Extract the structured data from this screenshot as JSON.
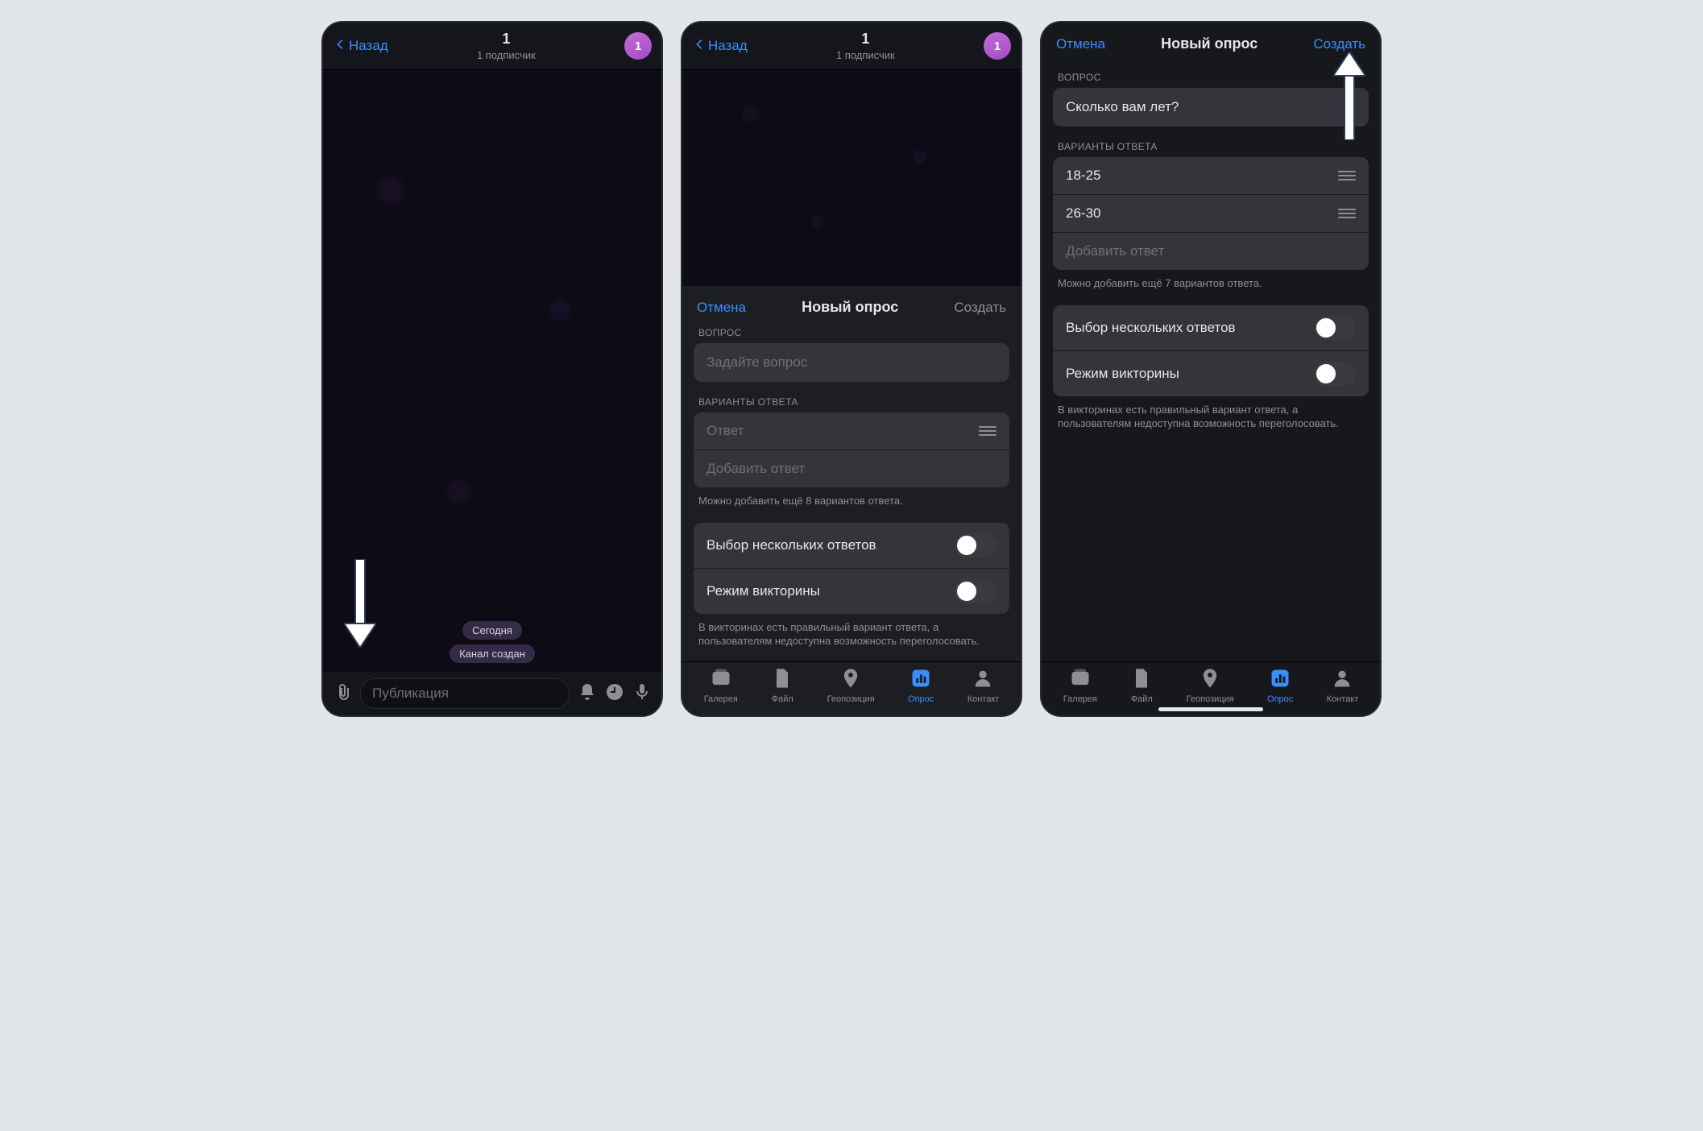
{
  "screen1": {
    "back_label": "Назад",
    "chat_title": "1",
    "chat_subtitle": "1 подписчик",
    "avatar_text": "1",
    "date_pill": "Сегодня",
    "created_pill": "Канал создан",
    "input_placeholder": "Публикация"
  },
  "screen2": {
    "back_label": "Назад",
    "chat_title": "1",
    "chat_subtitle": "1 подписчик",
    "avatar_text": "1",
    "sheet": {
      "cancel": "Отмена",
      "title": "Новый опрос",
      "create": "Создать",
      "question_section": "ВОПРОС",
      "question_placeholder": "Задайте вопрос",
      "options_section": "ВАРИАНТЫ ОТВЕТА",
      "option_placeholder": "Ответ",
      "add_option": "Добавить ответ",
      "options_hint": "Можно добавить ещё 8 вариантов ответа.",
      "toggle_multi": "Выбор нескольких ответов",
      "toggle_quiz": "Режим викторины",
      "quiz_hint": "В викторинах есть правильный вариант ответа, а пользователям недоступна возможность переголосовать."
    },
    "tabs": {
      "gallery": "Галерея",
      "file": "Файл",
      "location": "Геопозиция",
      "poll": "Опрос",
      "contact": "Контакт"
    }
  },
  "screen3": {
    "sheet": {
      "cancel": "Отмена",
      "title": "Новый опрос",
      "create": "Создать",
      "question_section": "ВОПРОС",
      "question_value": "Сколько вам лет?",
      "options_section": "ВАРИАНТЫ ОТВЕТА",
      "options": [
        "18-25",
        "26-30"
      ],
      "add_option": "Добавить ответ",
      "options_hint": "Можно добавить ещё 7 вариантов ответа.",
      "toggle_multi": "Выбор нескольких ответов",
      "toggle_quiz": "Режим викторины",
      "quiz_hint": "В викторинах есть правильный вариант ответа, а пользователям недоступна возможность переголосовать."
    },
    "tabs": {
      "gallery": "Галерея",
      "file": "Файл",
      "location": "Геопозиция",
      "poll": "Опрос",
      "contact": "Контакт"
    }
  }
}
